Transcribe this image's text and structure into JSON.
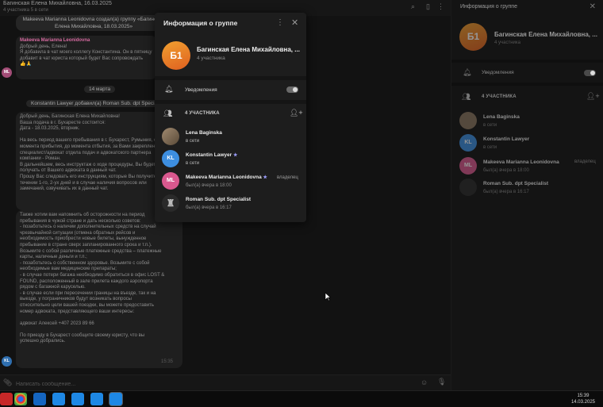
{
  "chat": {
    "header_title": "Багинская Елена Михайловна, 16.03.2025",
    "header_sub": "4 участника   5 в сети",
    "sys_created": "Makeeva Marianna Leonidovna создал(а) группу «Багинская Елена Михайловна, 18.03.2025»",
    "msg1_author": "Makeeva Marianna Leonidovna",
    "msg1_text": "Добрый день, Елена!\nЯ добавила в чат моего коллегу Константина. Он в пятницу\nдобавит в чат юриста который будет Вас сопровождать",
    "msg1_reactions": "👍🙏",
    "date_divider": "14 марта",
    "sys_added": "Konstantin Lawyer добавил(а) Roman Sub. dpt Specialist",
    "msg2_text": "Добрый день, Багинская Елена Михайловна!\nВаша подача в г. Бухаресте состоится:\nДата - 18.03.2025, вторник.\n\nНа весь период вашего пребывания в г. Бухарест, Румыния, с\nмомента прибытия, до момента отбытия, за Вами закреплен\nспециалист/адвокат отдела подач и адвокатского партнера\nкомпании - Роман.\nВ дальнейшем, весь инструктаж о ходе процедуры, Вы будете\nполучать от Вашего адвоката в данный чат.\nПрошу Вас следовать его инструкциям, которые Вы получите в\nтечении 1-го, 2-ух дней и в случае наличия вопросов или\nзамечаний, озвучивать их в данный чат.",
    "msg3_text": "Также хотим вам напомнить об осторожности на период\nпребывания в чужой стране и дать несколько советов:\n- позаботьтесь о наличии дополнительных средств на случай\nчрезвычайной ситуации (отмена обратных рейсов и\nнеобходимость приобрести новые билеты, вынужденное\nпребывание в стране сверх запланированного срока и т.п.).\nВозьмите с собой различные платежные средства – платежные\nкарты, наличные деньги и т.п.;\n- позаботьтесь о собственном здоровье. Возьмите с собой\nнеобходимые вам медицинские препараты;\n- в случае потери багажа необходимо обратиться в офис LOST &\nFOUND, расположенный в зале прилета каждого аэропорта\nрядом с багажной каруселью.\n- в случае если при пересечении границы на въезде, так и на\nвыезде, у пограничников будут возникать вопросы\nотносительно цели вашей поездки, вы можете предоставить\nномер адвоката, представляющего ваши интересы:\n\nадвокат Алексей +407 2023 89 66\n\nПо приезду в Бухарест сообщите своему юристу, что вы\nуспешно добрались.",
    "msg3_time": "15:35",
    "composer_placeholder": "Написать сообщение..."
  },
  "right_panel": {
    "title": "Информация о группе",
    "avatar_initials": "Б1",
    "group_name": "Багинская Елена Михайловна, ...",
    "member_count": "4 участника",
    "notifications_label": "Уведомления",
    "members_header": "4 УЧАСТНИКА",
    "members": [
      {
        "name": "Lena Baginska",
        "status": "в сети",
        "initials": ""
      },
      {
        "name": "Konstantin Lawyer",
        "status": "в сети",
        "initials": "KL"
      },
      {
        "name": "Makeeva Marianna Leonidovna",
        "status": "был(а) вчера в 18:00",
        "initials": "ML",
        "role": "владелец"
      },
      {
        "name": "Roman Sub. dpt Specialist",
        "status": "был(а) вчера в 16:17",
        "initials": ""
      }
    ]
  },
  "dialog": {
    "title": "Информация о группе",
    "avatar_initials": "Б1",
    "group_name": "Багинская Елена Михайловна, ...",
    "member_count": "4 участника",
    "notifications_label": "Уведомления",
    "notifications_on": true,
    "members_header": "4 УЧАСТНИКА",
    "members": [
      {
        "name": "Lena Baginska",
        "status": "в сети",
        "initials": "",
        "avatar_color": "#8a7560"
      },
      {
        "name": "Konstantin Lawyer",
        "status": "в сети",
        "initials": "KL",
        "avatar_color": "#3d8ee0",
        "star": "★"
      },
      {
        "name": "Makeeva Marianna Leonidovna",
        "status": "был(а) вчера в 18:00",
        "initials": "ML",
        "avatar_color": "#d9588e",
        "star": "★",
        "role": "владелец"
      },
      {
        "name": "Roman Sub. dpt Specialist",
        "status": "был(а) вчера в 16:17",
        "initials": "",
        "avatar_color": "#2a2a2a"
      }
    ]
  },
  "taskbar": {
    "time": "15:39",
    "date": "14.03.2025"
  }
}
